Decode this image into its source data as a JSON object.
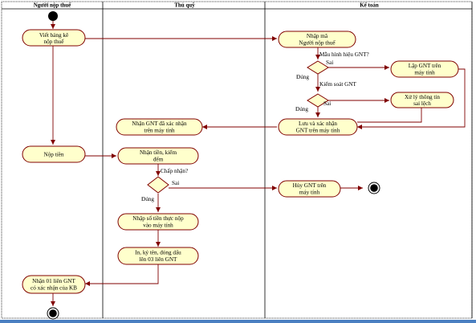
{
  "lanes": [
    {
      "id": "taxpayer",
      "title": "Người nộp thuế"
    },
    {
      "id": "cashier",
      "title": "Thủ quỹ"
    },
    {
      "id": "accountant",
      "title": "Kế toán"
    }
  ],
  "nodes": {
    "viet_bang_ke": [
      "Viết bảng kê",
      "nộp thuế"
    ],
    "nhap_ma": [
      "Nhập  mã",
      "Người nộp thuế"
    ],
    "lap_gnt": [
      "Lập GNT trên",
      "máy tính"
    ],
    "xu_ly": [
      "Xử lý thông tin",
      "sai lệch"
    ],
    "luu_xac_nhan": [
      "Lưu và xác nhận",
      "GNT trên máy tính"
    ],
    "nhan_gnt": [
      "Nhận GNT đã xác nhận",
      "trên máy tính"
    ],
    "nop_tien": [
      "Nộp tiền"
    ],
    "nhan_tien": [
      "Nhận tiền, kiểm",
      "đếm"
    ],
    "huy_gnt": [
      "Hủy GNT trên",
      "máy tính"
    ],
    "nhap_so_tien": [
      "Nhập số tiền thực nộp",
      "vào máy tính"
    ],
    "in_ky": [
      "In, ký tên, đóng dấu",
      "lên 03 liên GNT"
    ],
    "nhan_03": [
      "Nhận 01 liên GNT",
      "có xác nhận của KB"
    ]
  },
  "guards": {
    "mau_hinh": "Mẫu hình hiệu GNT?",
    "kiem_soat": "Kiểm soát GNT",
    "chap_nhan": "Chấp nhận?",
    "sai1": "Sai",
    "dung1": "Đúng",
    "sai2": "Sai",
    "dung2": "Đúng",
    "sai3": "Sai",
    "dung3": "Đúng"
  },
  "colors": {
    "node_fill": "#ffffcc",
    "node_stroke": "#800000",
    "edge": "#800000",
    "lane_line": "#000000",
    "bottom_bar": "#4a7fc1"
  }
}
